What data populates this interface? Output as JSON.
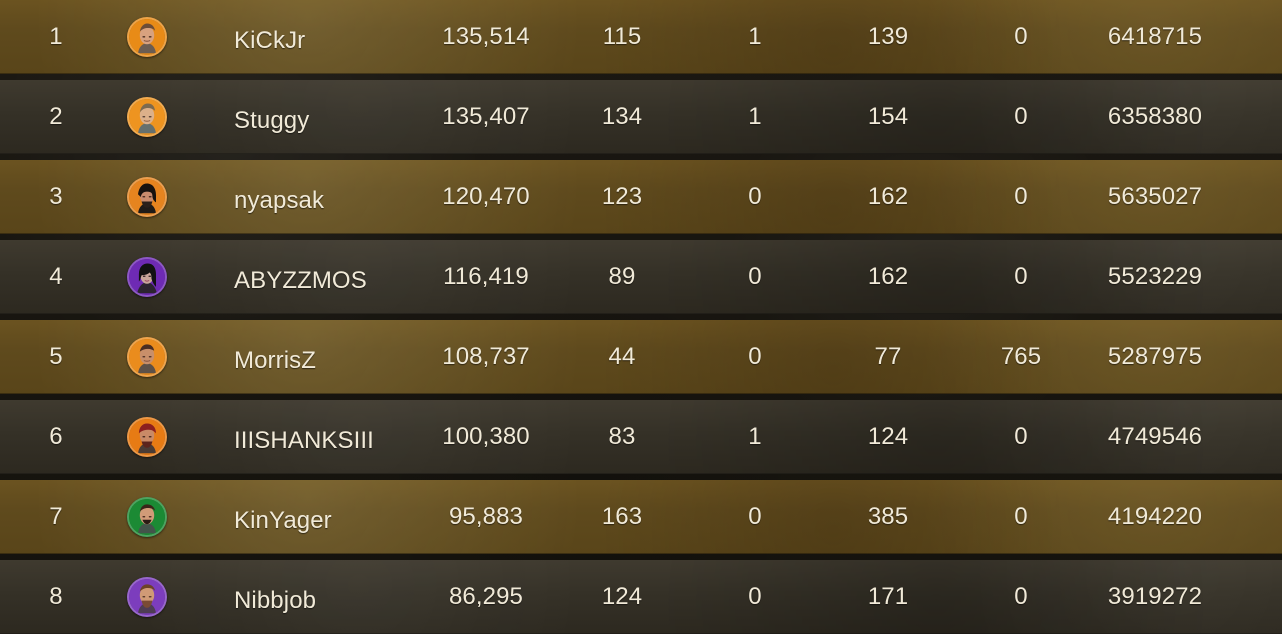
{
  "leaderboard": {
    "rows": [
      {
        "rank": "1",
        "avatar_icon": "player-portrait-icon",
        "avatar_color": "#e88b17",
        "name": "KiCkJr",
        "score": "135,514",
        "kills": "115",
        "wins": "1",
        "matches": "139",
        "extra": "0",
        "points": "6418715"
      },
      {
        "rank": "2",
        "avatar_icon": "player-portrait-icon",
        "avatar_color": "#ee9420",
        "name": "Stuggy",
        "score": "135,407",
        "kills": "134",
        "wins": "1",
        "matches": "154",
        "extra": "0",
        "points": "6358380"
      },
      {
        "rank": "3",
        "avatar_icon": "player-portrait-icon",
        "avatar_color": "#e6841f",
        "name": "nyapsak",
        "score": "120,470",
        "kills": "123",
        "wins": "0",
        "matches": "162",
        "extra": "0",
        "points": "5635027"
      },
      {
        "rank": "4",
        "avatar_icon": "player-portrait-icon",
        "avatar_color": "#6e2ab4",
        "name": "ABYZZMOS",
        "score": "116,419",
        "kills": "89",
        "wins": "0",
        "matches": "162",
        "extra": "0",
        "points": "5523229"
      },
      {
        "rank": "5",
        "avatar_icon": "player-portrait-icon",
        "avatar_color": "#ea8c1d",
        "name": "MorrisZ",
        "score": "108,737",
        "kills": "44",
        "wins": "0",
        "matches": "77",
        "extra": "765",
        "points": "5287975"
      },
      {
        "rank": "6",
        "avatar_icon": "player-portrait-icon",
        "avatar_color": "#e77b14",
        "name": "IIISHANKSIII",
        "score": "100,380",
        "kills": "83",
        "wins": "1",
        "matches": "124",
        "extra": "0",
        "points": "4749546"
      },
      {
        "rank": "7",
        "avatar_icon": "player-portrait-icon",
        "avatar_color": "#1b8a34",
        "name": "KinYager",
        "score": "95,883",
        "kills": "163",
        "wins": "0",
        "matches": "385",
        "extra": "0",
        "points": "4194220"
      },
      {
        "rank": "8",
        "avatar_icon": "player-portrait-icon",
        "avatar_color": "#7c3dbd",
        "name": "Nibbjob",
        "score": "86,295",
        "kills": "124",
        "wins": "0",
        "matches": "171",
        "extra": "0",
        "points": "3919272"
      }
    ]
  }
}
